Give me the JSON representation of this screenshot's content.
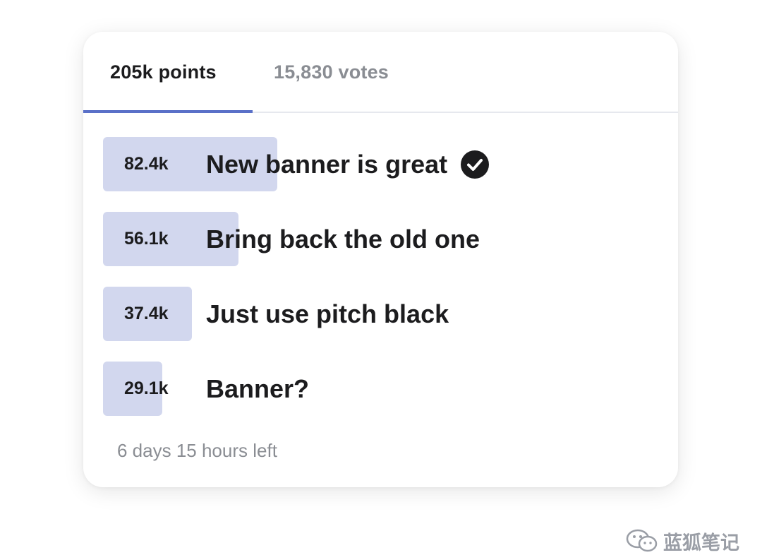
{
  "tabs": [
    {
      "label": "205k points",
      "active": true
    },
    {
      "label": "15,830 votes",
      "active": false
    }
  ],
  "options": [
    {
      "count": "82.4k",
      "label": "New banner is great",
      "fraction": 1.0,
      "selected": true
    },
    {
      "count": "56.1k",
      "label": "Bring back the old one",
      "fraction": 0.776,
      "selected": false
    },
    {
      "count": "37.4k",
      "label": "Just use pitch black",
      "fraction": 0.51,
      "selected": false
    },
    {
      "count": "29.1k",
      "label": "Banner?",
      "fraction": 0.34,
      "selected": false
    }
  ],
  "footer": {
    "time_left": "6 days 15 hours left"
  },
  "watermark": {
    "text": "蓝狐笔记",
    "icon": "wechat-icon"
  },
  "colors": {
    "accent": "#5a70c8",
    "bar": "#d2d7ee",
    "text_primary": "#1c1c1e",
    "text_secondary": "#8a8d93"
  }
}
